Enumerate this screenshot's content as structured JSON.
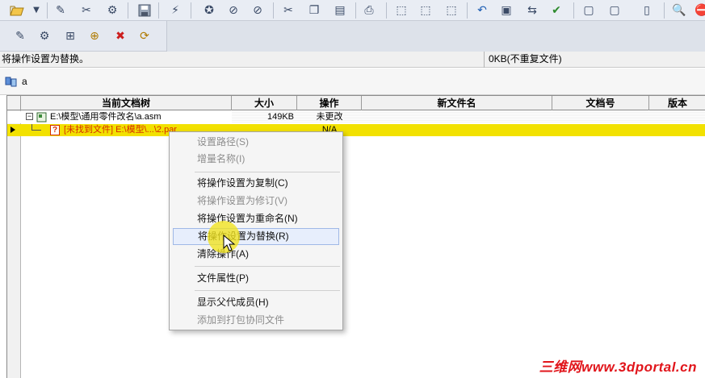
{
  "toolbar1": {
    "icons": [
      "new-open-icon",
      "dropdown-arrow-icon",
      "edit-icon",
      "magic-tool-icon",
      "settings-icon",
      "save-icon",
      "wand-icon",
      "star-circle-icon",
      "no-circle-icon",
      "no-circle-2-icon",
      "cut-icon",
      "copy-icon",
      "paste-icon",
      "print-icon",
      "select-box-icon",
      "select-box-2-icon",
      "select-box-3-icon",
      "undo-icon",
      "window-icon",
      "replace-icon",
      "check-window-icon",
      "frame-icon",
      "frame-2-icon",
      "page-2-icon",
      "zoom-icon",
      "stop-icon"
    ]
  },
  "toolbar2": {
    "icons": [
      "tree-edit-icon",
      "tree-settings-icon",
      "tree-expand-icon",
      "tree-add-icon",
      "tree-delete-icon",
      "tree-refresh-icon"
    ]
  },
  "status": {
    "message": "将操作设置为替换。",
    "file_info": "0KB(不重复文件)"
  },
  "assembly": {
    "name": "a"
  },
  "table": {
    "columns": [
      "当前文档树",
      "大小",
      "操作",
      "新文件名",
      "文档号",
      "版本"
    ],
    "rows": [
      {
        "doc": "E:\\模型\\通用零件改名\\a.asm",
        "size": "149KB",
        "action": "未更改",
        "highlighted": false
      },
      {
        "doc": "[未找到文件] E:\\模型\\...\\2.par",
        "size": "",
        "action": "N/A",
        "highlighted": true
      }
    ]
  },
  "context_menu": {
    "items": [
      {
        "label": "设置路径(S)",
        "enabled": false
      },
      {
        "label": "增量名称(I)",
        "enabled": false
      },
      {
        "label": "将操作设置为复制(C)",
        "enabled": true
      },
      {
        "label": "将操作设置为修订(V)",
        "enabled": false
      },
      {
        "label": "将操作设置为重命名(N)",
        "enabled": true
      },
      {
        "label": "将操作设置为替换(R)",
        "enabled": true,
        "hovered": true
      },
      {
        "label": "清除操作(A)",
        "enabled": true
      },
      {
        "label": "文件属性(P)",
        "enabled": true
      },
      {
        "label": "显示父代成员(H)",
        "enabled": true
      },
      {
        "label": "添加到打包协同文件",
        "enabled": false
      }
    ]
  },
  "watermark": "三维网www.3dportal.cn",
  "colors": {
    "highlight_row": "#f2e100",
    "missing_file_text": "#d62b00",
    "menu_hover": "#e7eefc",
    "cursor_halo": "#f1e31c"
  }
}
